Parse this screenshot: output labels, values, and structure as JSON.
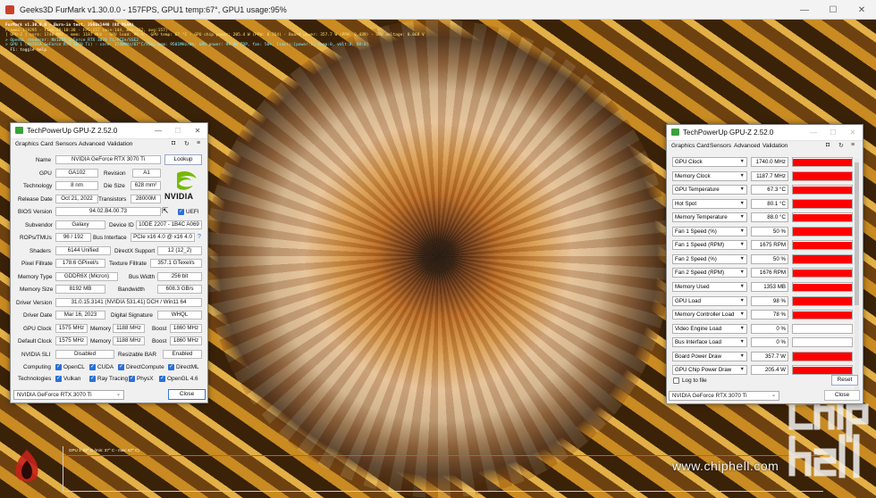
{
  "furmark": {
    "title": "Geeks3D FurMark v1.30.0.0 - 157FPS, GPU1 temp:67°, GPU1 usage:95%",
    "overlay": [
      "FurMark v1.30.0.0 - Burn-in test, 2560x1440 (8X MSAA)",
      "Frames:119295 - time:00:10:38 - FPS:157 (min:144, max:162, avg:157)",
      "[ GPU-Z ] core: 1740 MHz - mem: 1187 MHz - GPU load: 98 % - GPU temp: 67 °C - GPU chip power: 205.4 W (PPW: 0.764) - Board power: 357.7 W (PPW: 0.439) - GPU voltage: 0.868 V",
      "> OpenGL renderer: NVIDIA GeForce RTX 3070 Ti/PCIe/SSE2",
      "> GPU 1 (NVIDIA GeForce RTX 3070 Ti) - core: 1740MHz/67°C/95%, mem: 9501MHz/0%, GPU power: 99.8% TDP, fan: 50%, limits:[power:1, temp:0, volt:0, OV:0]",
      "- F1: toggle help"
    ],
    "graph_label": "GPU 1: 67° C (min: 37° C - max: 67° C)",
    "window_controls": [
      "—",
      "☐",
      "✕"
    ]
  },
  "watermark": {
    "text": "www.chiphell.com"
  },
  "gpuz_left": {
    "title": "TechPowerUp GPU-Z 2.52.0",
    "window_controls": [
      "—",
      "☐",
      "✕"
    ],
    "tabs": [
      "Graphics Card",
      "Sensors",
      "Advanced",
      "Validation"
    ],
    "tool_icons": [
      "camera-icon",
      "refresh-icon",
      "menu-icon"
    ],
    "tool_glyphs": [
      "◘",
      "↻",
      "≡"
    ],
    "vendor_logo_text": "NVIDIA",
    "labels": {
      "name": "Name",
      "gpu": "GPU",
      "revision": "Revision",
      "technology": "Technology",
      "die_size": "Die Size",
      "release_date": "Release Date",
      "transistors": "Transistors",
      "bios_version": "BIOS Version",
      "subvendor": "Subvendor",
      "device_id": "Device ID",
      "rops_tmus": "ROPs/TMUs",
      "bus_interface": "Bus Interface",
      "shaders": "Shaders",
      "directx": "DirectX Support",
      "pixel_fillrate": "Pixel Fillrate",
      "texture_fillrate": "Texture Fillrate",
      "memory_type": "Memory Type",
      "bus_width": "Bus Width",
      "memory_size": "Memory Size",
      "bandwidth": "Bandwidth",
      "driver_version": "Driver Version",
      "driver_date": "Driver Date",
      "digital_signature": "Digital Signature",
      "gpu_clock": "GPU Clock",
      "memory": "Memory",
      "boost": "Boost",
      "default_clock": "Default Clock",
      "nvidia_sli": "NVIDIA SLI",
      "resizable_bar": "Resizable BAR",
      "computing": "Computing",
      "technologies": "Technologies"
    },
    "values": {
      "name": "NVIDIA GeForce RTX 3070 Ti",
      "gpu": "GA102",
      "revision": "A1",
      "technology": "8 nm",
      "die_size": "628 mm²",
      "release_date": "Oct 21, 2022",
      "transistors": "28000M",
      "bios_version": "94.02.B4.00.73",
      "uefi": "UEFI",
      "subvendor": "Galaxy",
      "device_id": "10DE 2207 - 1B4C A069",
      "rops_tmus": "96 / 192",
      "bus_interface": "PCIe x16 4.0 @ x16 4.0",
      "shaders": "6144 Unified",
      "directx": "12 (12_2)",
      "pixel_fillrate": "178.6 GPixel/s",
      "texture_fillrate": "357.1 GTexel/s",
      "memory_type": "GDDR6X (Micron)",
      "bus_width": "256 bit",
      "memory_size": "8192 MB",
      "bandwidth": "608.3 GB/s",
      "driver_version": "31.0.15.3141 (NVIDIA 531.41) DCH / Win11 64",
      "driver_date": "Mar 16, 2023",
      "digital_signature": "WHQL",
      "gpu_clock": "1575 MHz",
      "gpu_memory": "1188 MHz",
      "gpu_boost": "1860 MHz",
      "default_clock": "1575 MHz",
      "default_memory": "1188 MHz",
      "default_boost": "1860 MHz",
      "nvidia_sli": "Disabled",
      "resizable_bar": "Enabled"
    },
    "computing": [
      "OpenCL",
      "CUDA",
      "DirectCompute",
      "DirectML"
    ],
    "technologies": [
      "Vulkan",
      "Ray Tracing",
      "PhysX",
      "OpenGL 4.6"
    ],
    "lookup_button": "Lookup",
    "gpu_select": "NVIDIA GeForce RTX 3070 Ti",
    "close_button": "Close",
    "help_glyph": "?"
  },
  "gpuz_right": {
    "title": "TechPowerUp GPU-Z 2.52.0",
    "window_controls": [
      "—",
      "☐",
      "✕"
    ],
    "tabs": [
      "Graphics Card",
      "Sensors",
      "Advanced",
      "Validation"
    ],
    "tool_glyphs": [
      "◘",
      "↻",
      "≡"
    ],
    "sensors": [
      {
        "name": "GPU Clock",
        "value": "1740.0 MHz",
        "level": 0.93
      },
      {
        "name": "Memory Clock",
        "value": "1187.7 MHz",
        "level": 0.93
      },
      {
        "name": "GPU Temperature",
        "value": "67.3 °C",
        "level": 0.93
      },
      {
        "name": "Hot Spot",
        "value": "80.1 °C",
        "level": 0.93
      },
      {
        "name": "Memory Temperature",
        "value": "88.0 °C",
        "level": 0.93
      },
      {
        "name": "Fan 1 Speed (%)",
        "value": "50 %",
        "level": 0.93
      },
      {
        "name": "Fan 1 Speed (RPM)",
        "value": "1675 RPM",
        "level": 0.93
      },
      {
        "name": "Fan 2 Speed (%)",
        "value": "50 %",
        "level": 0.93
      },
      {
        "name": "Fan 2 Speed (RPM)",
        "value": "1676 RPM",
        "level": 0.93
      },
      {
        "name": "Memory Used",
        "value": "1353 MB",
        "level": 0.93
      },
      {
        "name": "GPU Load",
        "value": "98 %",
        "level": 0.93
      },
      {
        "name": "Memory Controller Load",
        "value": "78 %",
        "level": 0.93
      },
      {
        "name": "Video Engine Load",
        "value": "0 %",
        "level": 0.0
      },
      {
        "name": "Bus Interface Load",
        "value": "0 %",
        "level": 0.0
      },
      {
        "name": "Board Power Draw",
        "value": "357.7 W",
        "level": 0.93
      },
      {
        "name": "GPU Chip Power Draw",
        "value": "205.4 W",
        "level": 0.93
      }
    ],
    "log_to_file": "Log to file",
    "reset_button": "Reset",
    "gpu_select": "NVIDIA GeForce RTX 3070 Ti",
    "close_button": "Close"
  },
  "colors": {
    "sensor_bar": "#ff0000",
    "accent": "#2b6fd6",
    "nvidia_green": "#76b900"
  }
}
